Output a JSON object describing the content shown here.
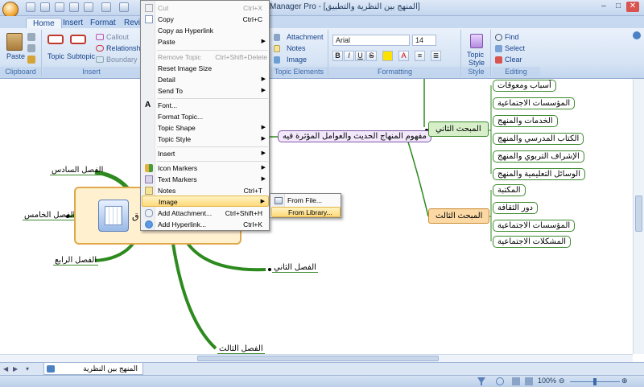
{
  "window": {
    "title": "Mindjet MindManager Pro - [المنهج بين النظرية والتطبيق]"
  },
  "ribbon": {
    "tabs": [
      "Home",
      "Insert",
      "Format",
      "Review"
    ],
    "clipboard": {
      "paste": "Paste",
      "label": "Clipboard"
    },
    "insert": {
      "topic": "Topic",
      "subtopic": "Subtopic",
      "callout": "Callout",
      "relationship": "Relationship",
      "boundary": "Boundary",
      "label": "Insert"
    },
    "topic_elements": {
      "attachment": "Attachment",
      "notes": "Notes",
      "image": "Image",
      "label": "Topic Elements"
    },
    "formatting": {
      "font": "Arial",
      "size": "14",
      "label": "Formatting",
      "bold": "B",
      "italic": "I",
      "underline": "U",
      "strike": "S"
    },
    "style": {
      "topic_style": "Topic",
      "topic_style2": "Style",
      "label": "Style"
    },
    "editing": {
      "find": "Find",
      "select": "Select",
      "clear": "Clear",
      "label": "Editing"
    }
  },
  "context_menu": {
    "items": [
      {
        "label": "Cut",
        "shortcut": "Ctrl+X",
        "disabled": true
      },
      {
        "label": "Copy",
        "shortcut": "Ctrl+C"
      },
      {
        "label": "Copy as Hyperlink",
        "shortcut": ""
      },
      {
        "label": "Paste",
        "shortcut": "",
        "submenu": true
      },
      {
        "label": "Remove Topic",
        "shortcut": "Ctrl+Shift+Delete",
        "disabled": true
      },
      {
        "label": "Reset Image Size",
        "shortcut": ""
      },
      {
        "label": "Detail",
        "shortcut": "",
        "submenu": true
      },
      {
        "label": "Send To",
        "shortcut": "",
        "submenu": true
      },
      {
        "label": "Font...",
        "shortcut": ""
      },
      {
        "label": "Format Topic...",
        "shortcut": ""
      },
      {
        "label": "Topic Shape",
        "shortcut": "",
        "submenu": true
      },
      {
        "label": "Topic Style",
        "shortcut": "",
        "submenu": true
      },
      {
        "label": "Insert",
        "shortcut": "",
        "submenu": true
      },
      {
        "label": "Icon Markers",
        "shortcut": "",
        "submenu": true
      },
      {
        "label": "Text Markers",
        "shortcut": "",
        "submenu": true
      },
      {
        "label": "Notes",
        "shortcut": "Ctrl+T"
      },
      {
        "label": "Image",
        "shortcut": "",
        "submenu": true,
        "highlighted": true
      },
      {
        "label": "Add Attachment...",
        "shortcut": "Ctrl+Shift+H"
      },
      {
        "label": "Add Hyperlink...",
        "shortcut": "Ctrl+K"
      }
    ],
    "image_submenu": [
      "From File...",
      "From Library..."
    ]
  },
  "map": {
    "central_topic_visible_text": "ق",
    "main_topic": "مفهوم المنهاج الحديث والعوامل المؤثرة فيه",
    "branch2": {
      "label": "المبحث الثاني",
      "children": [
        "أسباب ومعوقات",
        "المؤسسات الاجتماعية",
        "الخدمات والمنهج",
        "الكتاب المدرسي والمنهج",
        "الإشراف التربوي والمنهج",
        "الوسائل التعليمية والمنهج"
      ]
    },
    "branch3": {
      "label": "المبحث الثالث",
      "children": [
        "المكتبة",
        "دور الثقافة",
        "المؤسسات الاجتماعية",
        "المشكلات الاجتماعية"
      ]
    },
    "chapters": [
      "الفصل السادس",
      "الفصل الخامس",
      "الفصل الرابع",
      "الفصل الثاني",
      "الفصل الثالث"
    ]
  },
  "doc_tab": "المنهج بين النظرية والتطبيق",
  "status": {
    "zoom": "100%"
  },
  "colors": {
    "branch_green": "#2d8a1e",
    "branch2_fill": "#d6efc9",
    "branch3_fill": "#fbd8a4",
    "central_fill": "#fff0d0",
    "highlight": "#ffd97a"
  }
}
